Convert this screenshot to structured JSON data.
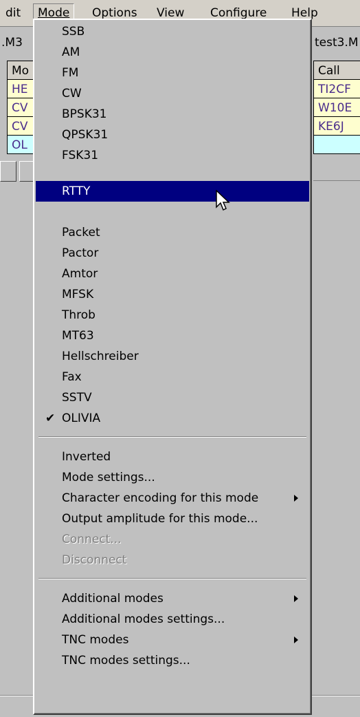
{
  "menubar": {
    "edit": "dit",
    "mode": "Mode",
    "options": "Options",
    "view": "View",
    "configure": "Configure",
    "help": "Help"
  },
  "background": {
    "tab_left": ".M3",
    "tab_right": "test3.M",
    "grid_left_header": "Mo",
    "grid_left_rows": [
      "HE",
      "CV",
      "CV",
      "OL"
    ],
    "grid_right_header": "Call",
    "grid_right_rows": [
      "TI2CF",
      "W10E",
      "KE6J",
      ""
    ]
  },
  "mode_menu": {
    "items": [
      {
        "label": "SSB"
      },
      {
        "label": "AM"
      },
      {
        "label": "FM"
      },
      {
        "label": "CW"
      },
      {
        "label": "BPSK31"
      },
      {
        "label": "QPSK31"
      },
      {
        "label": "FSK31"
      },
      {
        "label": "RTTY",
        "highlighted": true
      },
      {
        "label": "Packet"
      },
      {
        "label": "Pactor"
      },
      {
        "label": "Amtor"
      },
      {
        "label": "MFSK"
      },
      {
        "label": "Throb"
      },
      {
        "label": "MT63"
      },
      {
        "label": "Hellschreiber"
      },
      {
        "label": "Fax"
      },
      {
        "label": "SSTV"
      },
      {
        "label": "OLIVIA",
        "checked": true
      }
    ],
    "check_glyph": "✔",
    "group2": {
      "inverted": "Inverted",
      "mode_settings": "Mode settings...",
      "char_encoding": "Character encoding for this mode",
      "output_amplitude": "Output amplitude for this mode...",
      "connect": "Connect...",
      "disconnect": "Disconnect"
    },
    "group3": {
      "additional_modes": "Additional modes",
      "additional_modes_settings": "Additional modes settings...",
      "tnc_modes": "TNC modes",
      "tnc_modes_settings": "TNC modes settings..."
    }
  },
  "colors": {
    "highlight": "#000080",
    "menu_bg": "#c0c0c0",
    "row_bg": "#fefecf",
    "row_text": "#4a2c8c",
    "selected_row_bg": "#ccffff"
  }
}
